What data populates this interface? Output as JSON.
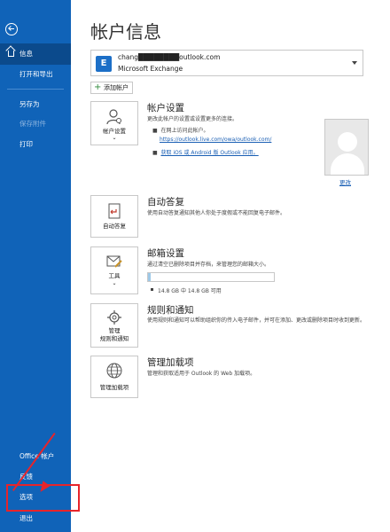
{
  "sidebar": {
    "info_label": "信息",
    "open_export_label": "打开和导出",
    "save_as_label": "另存为",
    "save_attachments_label": "保存附件",
    "print_label": "打印",
    "office_account_label": "Office 帐户",
    "feedback_label": "反馈",
    "options_label": "选项",
    "exit_label": "退出"
  },
  "main": {
    "title": "帐户信息",
    "account": {
      "email": "chang████████outlook.com",
      "type": "Microsoft Exchange",
      "icon_letter": "E"
    },
    "add_account_label": "添加帐户",
    "account_settings": {
      "tile_label": "帐户设置",
      "title": "帐户设置",
      "desc": "更改此帐户的设置或设置更多的连接。",
      "bullet1": "在网上访问此帐户。",
      "url": "https://outlook.live.com/owa/outlook.com/",
      "bullet2": "获取 iOS 或 Android 版 Outlook 应用。",
      "change_label": "更改"
    },
    "auto_reply": {
      "tile_label": "自动答复",
      "title": "自动答复",
      "desc": "使用自动答复通知其他人你处于度假或不能回复电子邮件。"
    },
    "mailbox": {
      "tile_label": "工具",
      "title": "邮箱设置",
      "desc": "通过清空已删除项目并存档，来管理您的邮箱大小。",
      "quota": "14.8 GB 中 14.8 GB 可用",
      "used_fraction": 0.01
    },
    "rules": {
      "tile_label_1": "管理",
      "tile_label_2": "规则和通知",
      "title": "规则和通知",
      "desc": "使用规则和通知可以帮助组织你的传入电子邮件，并可在添加、更改或删除项目时收到更新。"
    },
    "addins": {
      "tile_label": "管理加载项",
      "title": "管理加载项",
      "desc": "管理和获取适用于 Outlook 的 Web 加载项。"
    }
  },
  "colors": {
    "sidebar_bg": "#1063b8",
    "sidebar_active": "#0b4a8c",
    "highlight": "#e8242a",
    "link": "#1a5fb4"
  }
}
